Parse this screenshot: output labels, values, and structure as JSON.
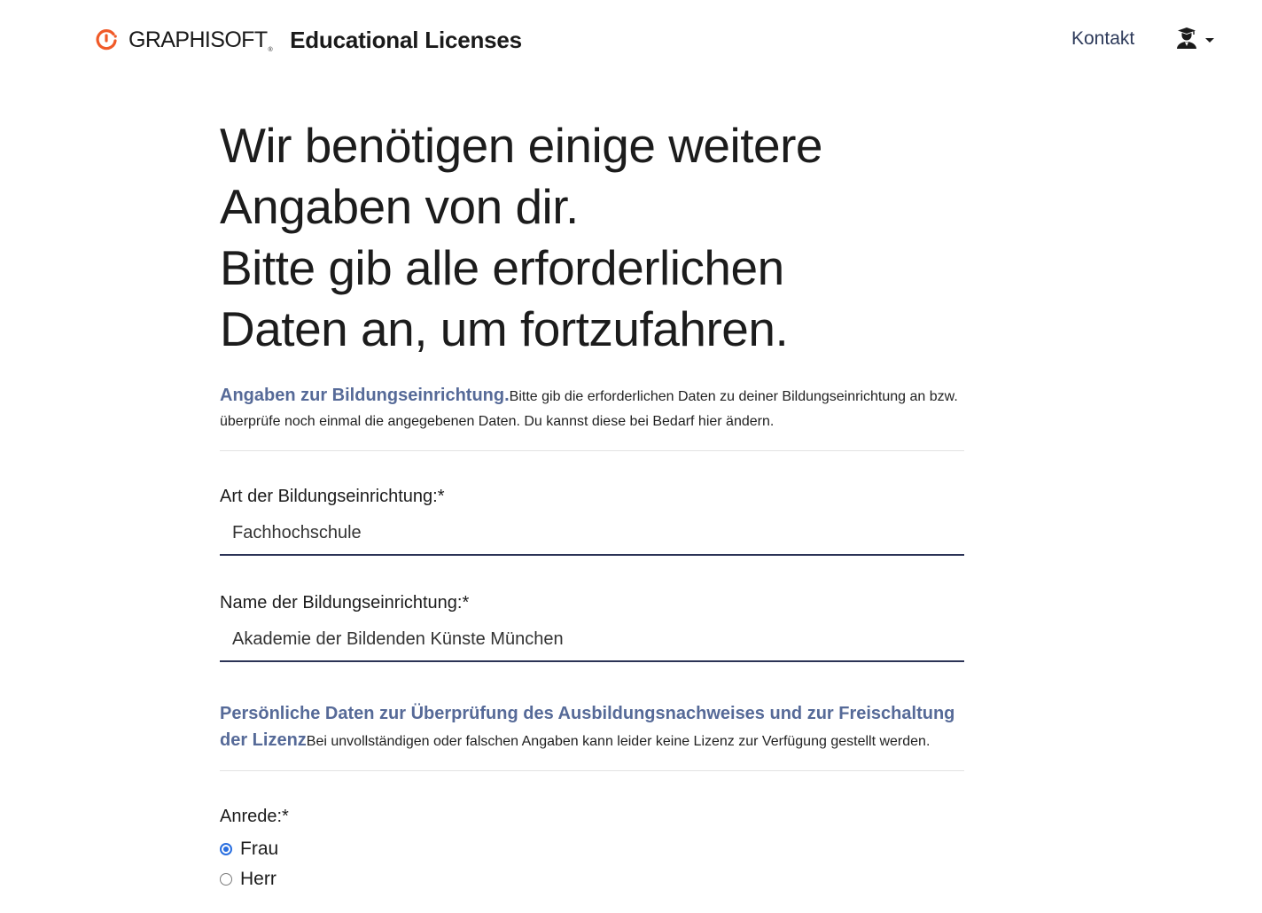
{
  "header": {
    "brand": "GRAPHISOFT",
    "brand_mark": "®",
    "app_title": "Educational Licenses",
    "nav_contact": "Kontakt",
    "user_icon": "student-avatar-icon"
  },
  "headline": {
    "line1": "Wir benötigen einige weitere",
    "line2": "Angaben von dir.",
    "line3": "Bitte gib alle erforderlichen",
    "line4": "Daten an, um fortzufahren."
  },
  "institution_section": {
    "lead": "Angaben zur Bildungseinrichtung.",
    "text": "Bitte gib die erforderlichen Daten zu deiner Bildungseinrichtung an bzw. überprüfe noch einmal die angegebenen Daten. Du kannst diese bei Bedarf hier ändern."
  },
  "fields": {
    "institution_type": {
      "label": "Art der Bildungseinrichtung:*",
      "value": "Fachhochschule"
    },
    "institution_name": {
      "label": "Name der Bildungseinrichtung:*",
      "value": "Akademie der Bildenden Künste München"
    }
  },
  "personal_section": {
    "lead": "Persönliche Daten zur Überprüfung des Ausbildungsnachweises und zur Freischaltung der Lizenz",
    "text": "Bei unvollständigen oder falschen Angaben kann leider keine Lizenz zur Verfügung gestellt werden."
  },
  "salutation": {
    "label": "Anrede:*",
    "options": [
      {
        "label": "Frau",
        "checked": true
      },
      {
        "label": "Herr",
        "checked": false
      }
    ]
  },
  "colors": {
    "accent_blue": "#566a98",
    "logo_orange": "#f05a28",
    "radio_blue": "#2a6fe0",
    "input_underline": "#2b3356"
  }
}
